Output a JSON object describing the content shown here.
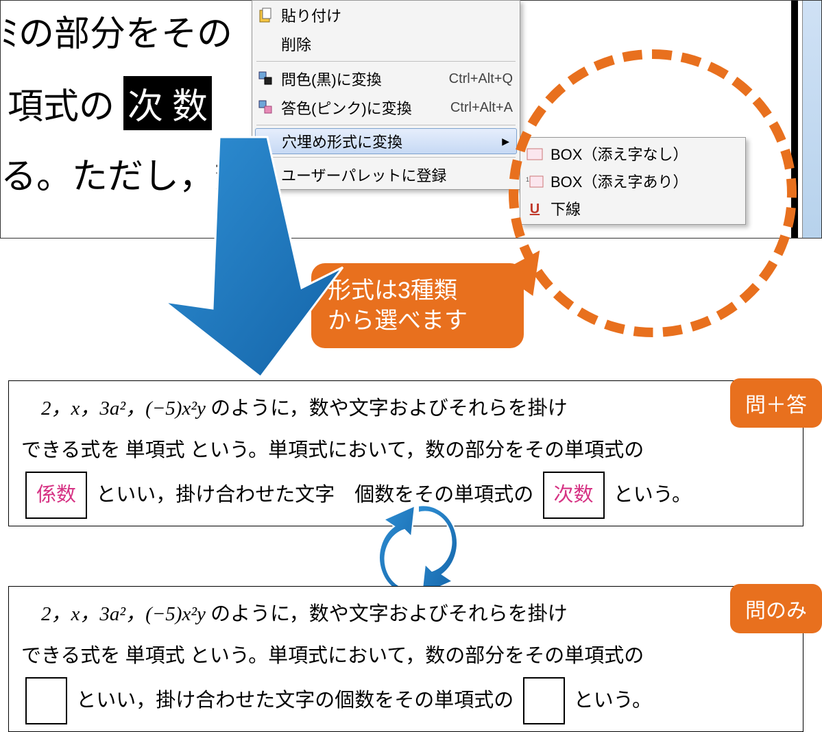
{
  "top_doc": {
    "line1": "ﾐの部分をその",
    "line2_prefix": "項式の ",
    "line2_selected": "次 数",
    "line3": "る。ただし，数"
  },
  "context_menu": {
    "paste": "貼り付け",
    "delete": "削除",
    "to_q_color": "問色(黒)に変換",
    "to_q_color_sc": "Ctrl+Alt+Q",
    "to_a_color": "答色(ピンク)に変換",
    "to_a_color_sc": "Ctrl+Alt+A",
    "to_blank": "穴埋め形式に変換",
    "register_palette": "ユーザーパレットに登録"
  },
  "submenu": {
    "box_no_sub": "BOX（添え字なし）",
    "box_with_sub": "BOX（添え字あり）",
    "underline": "下線"
  },
  "callout": {
    "line1": "形式は3種類",
    "line2": "から選べます"
  },
  "box_qa": {
    "math_lead": "　2，x，3a²，(−5)x²y ",
    "t1": "のように，数や文字およびそれらを掛け",
    "t2": "できる式を 単項式 という。単項式において，数の部分をその単項式の",
    "blank1": "係数",
    "t3": "といい，掛け合わせた文字　個数をその単項式の",
    "blank2": "次数",
    "t4": "という。"
  },
  "box_q": {
    "math_lead": "　2，x，3a²，(−5)x²y ",
    "t1": "のように，数や文字およびそれらを掛け",
    "t2": "できる式を 単項式 という。単項式において，数の部分をその単項式の",
    "t3": "といい，掛け合わせた文字の個数をその単項式の",
    "t4": "という。"
  },
  "tags": {
    "qa": "問＋答",
    "q": "問のみ"
  }
}
